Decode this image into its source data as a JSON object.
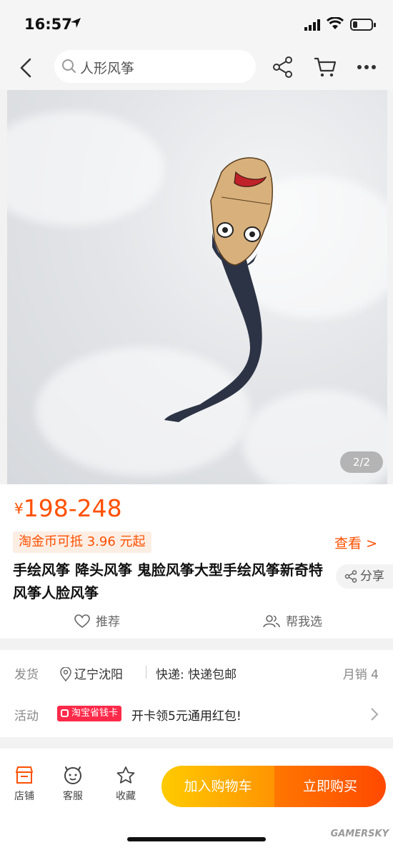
{
  "status_bar": {
    "time": "16:57"
  },
  "search": {
    "placeholder": "人形风筝"
  },
  "gallery": {
    "counter": "2/2"
  },
  "product": {
    "price_symbol": "¥",
    "price_range": "198-248",
    "coin_offer": "淘金币可抵 3.96 元起",
    "view_more": "查看 >",
    "title": "手绘风筝 降头风筝 鬼脸风筝大型手绘风筝新奇特风筝人脸风筝",
    "share_label": "分享",
    "recommend_label": "推荐",
    "help_pick_label": "帮我选"
  },
  "shipping": {
    "label": "发货",
    "location": "辽宁沈阳",
    "express": "快递: 快递包邮",
    "monthly_sales": "月销 4"
  },
  "activity": {
    "label": "活动",
    "badge": "淘宝省钱卡",
    "text": "开卡领5元通用红包!"
  },
  "bottom_bar": {
    "store": "店铺",
    "service": "客服",
    "favorite": "收藏",
    "add_to_cart": "加入购物车",
    "buy_now": "立即购买"
  },
  "watermark": "GAMERSKY",
  "colors": {
    "accent": "#ff5000",
    "cart_gradient": [
      "#ffcb00",
      "#ff9402"
    ],
    "buy_gradient": [
      "#ff7700",
      "#ff4900"
    ]
  }
}
